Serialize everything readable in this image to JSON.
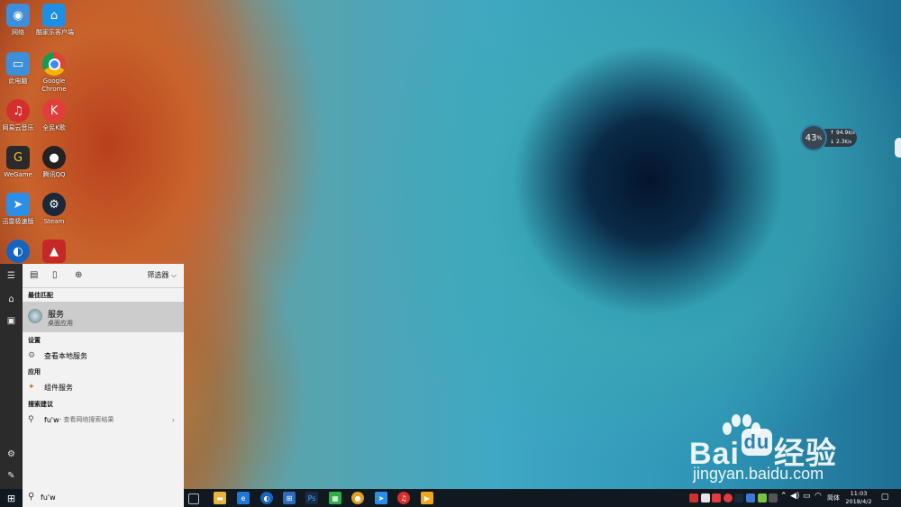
{
  "desktop": {
    "icons": [
      {
        "label": "网络",
        "icon": "network-icon",
        "color": "#3c8fd8"
      },
      {
        "label": "酷家乐客户端",
        "icon": "kujiale-icon",
        "color": "#1f8fe6"
      },
      {
        "label": "此电脑",
        "icon": "computer-icon",
        "color": "#3c8fd8"
      },
      {
        "label": "Google Chrome",
        "icon": "chrome-icon",
        "color": "#e8e8e8"
      },
      {
        "label": "网易云音乐",
        "icon": "netease-music-icon",
        "color": "#d62d2d"
      },
      {
        "label": "全民K歌",
        "icon": "kge-icon",
        "color": "#e23d3d"
      },
      {
        "label": "WeGame",
        "icon": "wegame-icon",
        "color": "#2a2a2a"
      },
      {
        "label": "腾讯QQ",
        "icon": "qq-icon",
        "color": "#222222"
      },
      {
        "label": "迅雷极速版",
        "icon": "xunlei-icon",
        "color": "#2b8fe6"
      },
      {
        "label": "Steam",
        "icon": "steam-icon",
        "color": "#1b2838"
      },
      {
        "label": "",
        "icon": "browser-icon",
        "color": "#1565c0"
      },
      {
        "label": "",
        "icon": "autodesk-icon",
        "color": "#c62828"
      }
    ]
  },
  "net_meter": {
    "percent": "43",
    "percent_unit": "%",
    "upload": "94.9",
    "upload_unit": "K/s",
    "download": "2.3",
    "download_unit": "K/s"
  },
  "watermark": {
    "brand": "Bai",
    "brand2": "经验",
    "site": "jingyan.baidu.com"
  },
  "start_menu": {
    "filter_label": "筛选器",
    "sections": {
      "best_match": "最佳匹配",
      "settings": "设置",
      "apps": "应用",
      "search_suggestions": "搜索建议"
    },
    "best_match_item": {
      "title": "服务",
      "subtitle": "桌面应用"
    },
    "settings_item": "查看本地服务",
    "apps_item": "组件服务",
    "suggestion": {
      "query": "fu'w",
      "hint": " - 查看网络搜索结果"
    }
  },
  "taskbar": {
    "search_value": "fu'w",
    "apps": [
      {
        "icon": "task-view-icon",
        "color": "#101820"
      },
      {
        "icon": "file-explorer-icon",
        "color": "#e8b53a"
      },
      {
        "icon": "edge-icon",
        "color": "#1e78d7"
      },
      {
        "icon": "browser-icon",
        "color": "#1565c0"
      },
      {
        "icon": "store-icon",
        "color": "#2c6bbf"
      },
      {
        "icon": "photoshop-icon",
        "color": "#1a2a4a"
      },
      {
        "icon": "calendar-icon",
        "color": "#2fae47"
      },
      {
        "icon": "chrome-icon",
        "color": "#e0a020"
      },
      {
        "icon": "xunlei-icon",
        "color": "#2b8fe6"
      },
      {
        "icon": "netease-music-icon",
        "color": "#d62d2d"
      },
      {
        "icon": "media-icon",
        "color": "#f2a81d"
      }
    ],
    "ime": "简体",
    "time": "11:03",
    "date": "2018/4/2"
  }
}
